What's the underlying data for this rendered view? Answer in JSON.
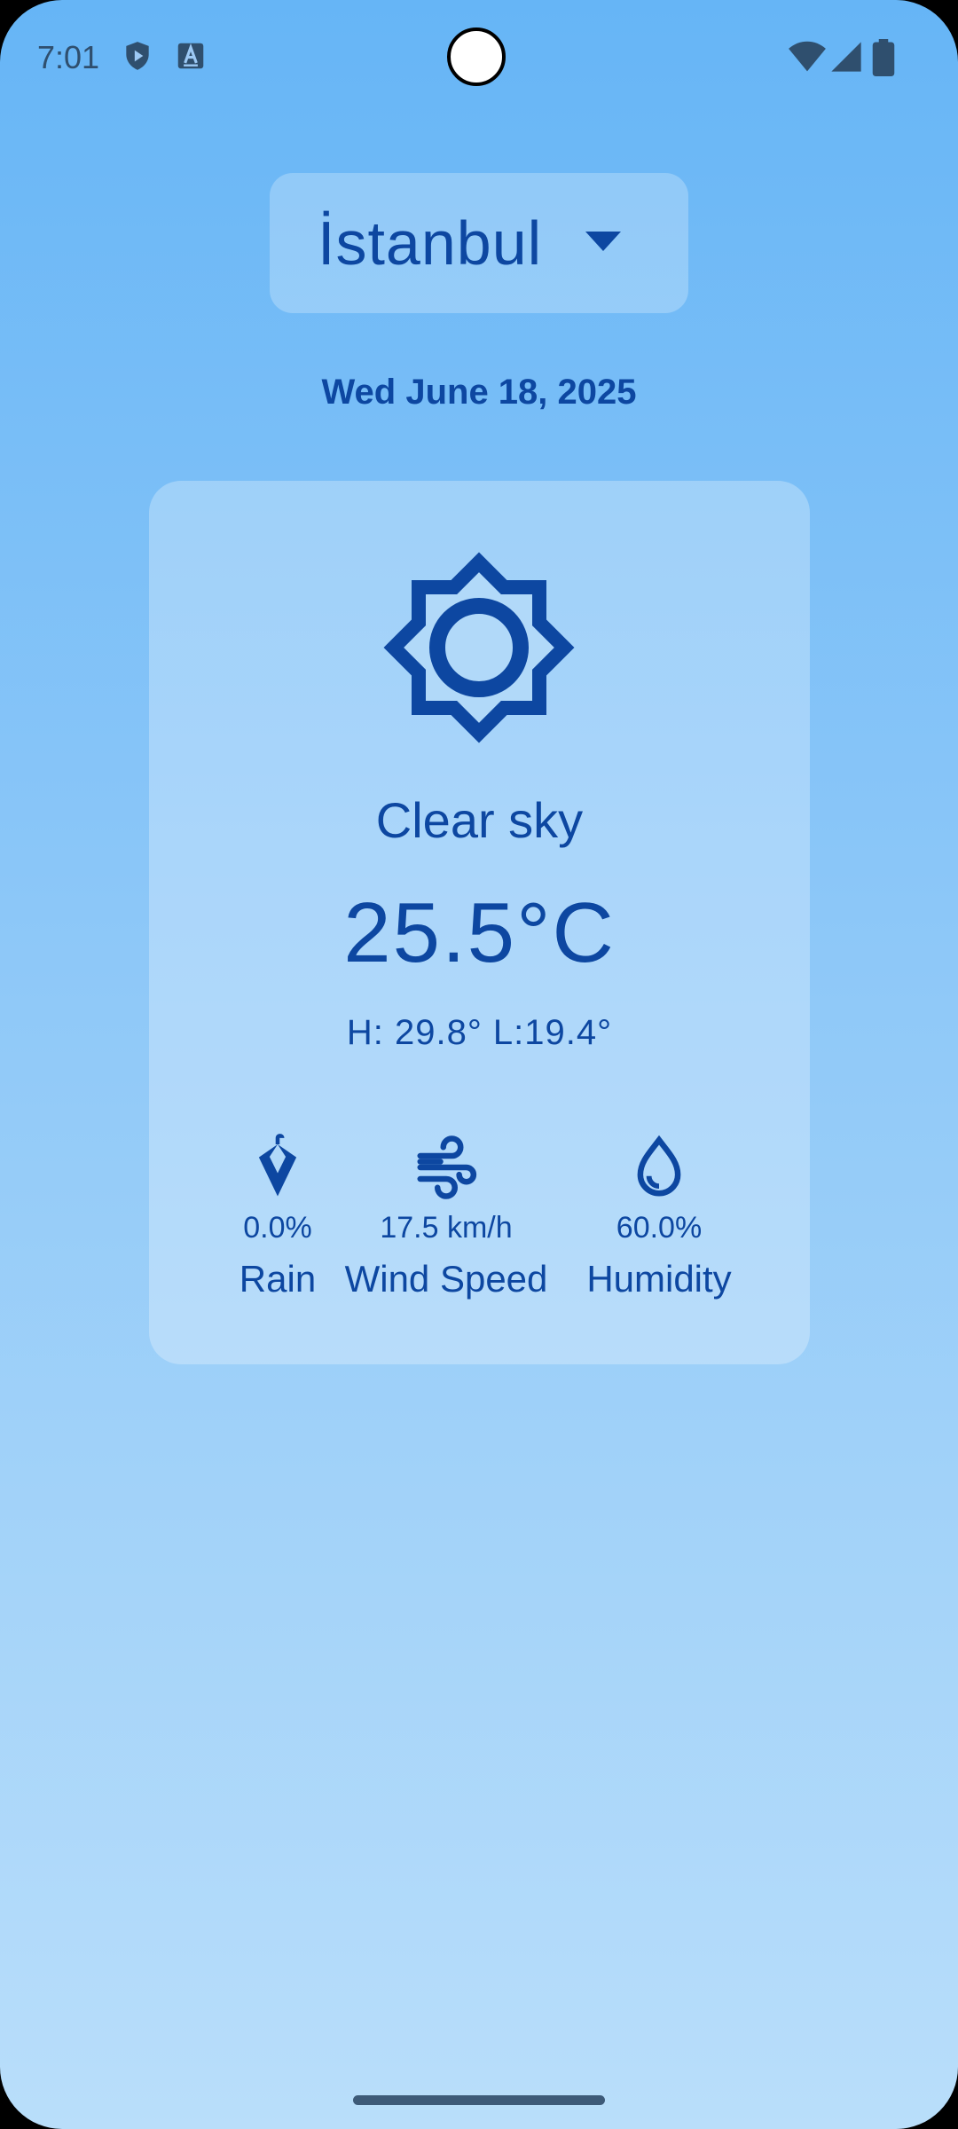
{
  "status_bar": {
    "time": "7:01",
    "icons": [
      "play-shield-icon",
      "accessibility-a-icon",
      "wifi-icon",
      "signal-icon",
      "battery-icon"
    ]
  },
  "city_selector": {
    "selected": "İstanbul",
    "icon": "chevron-down-icon"
  },
  "date": "Wed June 18, 2025",
  "weather": {
    "icon": "sun-icon",
    "condition": "Clear sky",
    "temperature": "25.5°C",
    "high_low": "H: 29.8° L:19.4°"
  },
  "stats": [
    {
      "icon": "umbrella-icon",
      "value": "0.0%",
      "label": "Rain"
    },
    {
      "icon": "wind-icon",
      "value": "17.5 km/h",
      "label": "Wind Speed"
    },
    {
      "icon": "water-drop-icon",
      "value": "60.0%",
      "label": "Humidity"
    }
  ],
  "colors": {
    "accent": "#0d47a1",
    "background_top": "#66b5f6",
    "background_bottom": "#b9defa"
  }
}
